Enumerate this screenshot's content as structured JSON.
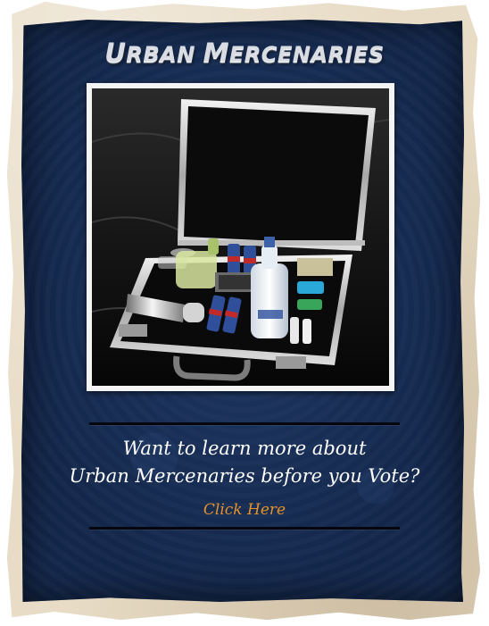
{
  "header": {
    "title_part1_big": "U",
    "title_part1_rest": "RBAN ",
    "title_part2_big": "M",
    "title_part2_rest": "ERCENARIES"
  },
  "promo": {
    "line1": "Want to learn more about",
    "line2": "Urban Mercenaries before you Vote?",
    "link_label": "Click Here"
  },
  "colors": {
    "panel_blue": "#14284d",
    "paper": "#e8dcc6",
    "link_orange": "#e5922b"
  }
}
